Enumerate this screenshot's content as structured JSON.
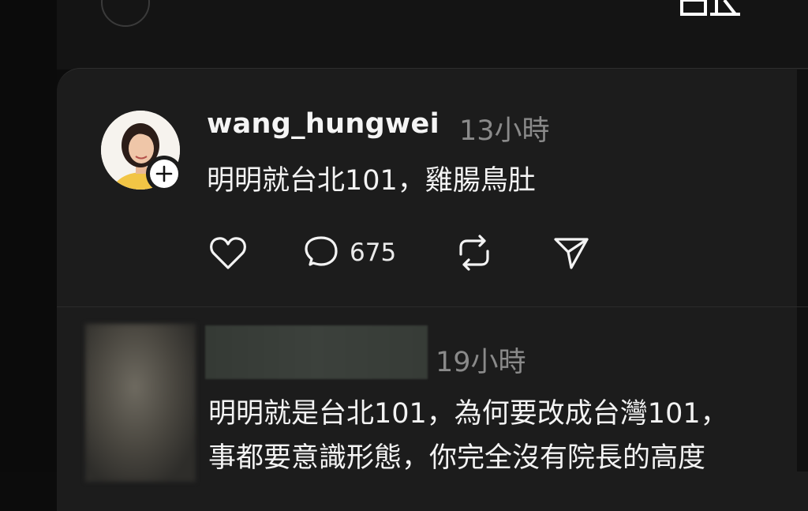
{
  "header": {
    "back_icon": "back-icon",
    "top_right_icon": "partial-glyph-icon"
  },
  "post": {
    "username": "wang_hungwei",
    "time": "13小時",
    "text": "明明就台北101，雞腸鳥肚",
    "avatar_icon": "profile-photo",
    "follow_icon": "plus-icon",
    "actions": {
      "like_icon": "heart-icon",
      "comment_icon": "comment-icon",
      "comment_count": "675",
      "repost_icon": "repost-icon",
      "share_icon": "send-icon"
    }
  },
  "reply": {
    "time": "19小時",
    "line1": "明明就是台北101，為何要改成台灣101，",
    "line2": "事都要意識形態，你完全沒有院長的高度"
  }
}
